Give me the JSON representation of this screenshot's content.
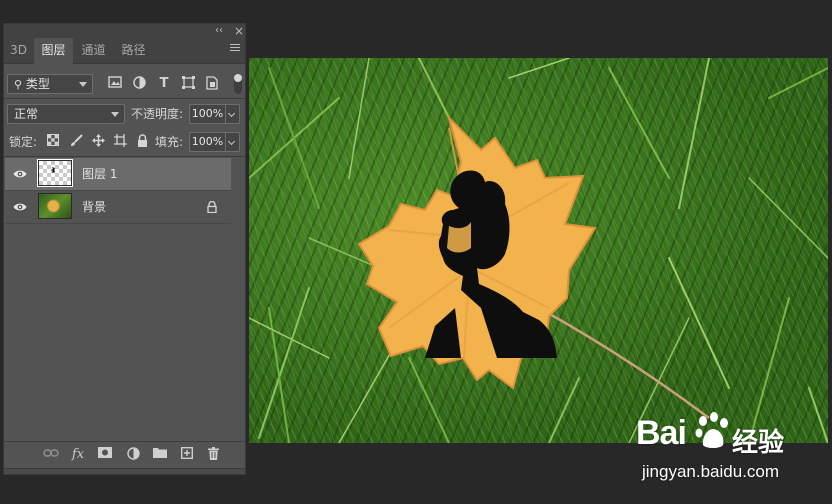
{
  "panel": {
    "collapse_glyph": "‹‹",
    "close_glyph": "×",
    "tabs": [
      {
        "label": "3D"
      },
      {
        "label": "图层"
      },
      {
        "label": "通道"
      },
      {
        "label": "路径"
      }
    ],
    "active_tab": "图层",
    "filter": {
      "label": "类型",
      "icon": "search-icon"
    },
    "filter_icons": [
      "image-filter-icon",
      "adjustment-filter-icon",
      "text-filter-icon",
      "shape-filter-icon",
      "smart-object-filter-icon"
    ],
    "blend_mode": "正常",
    "opacity_label": "不透明度:",
    "opacity_value": "100%",
    "lock_label": "锁定:",
    "lock_icons": [
      "lock-transparent-icon",
      "lock-paint-icon",
      "lock-position-icon",
      "lock-artboard-icon",
      "lock-all-icon"
    ],
    "fill_label": "填充:",
    "fill_value": "100%",
    "layers": [
      {
        "name": "图层 1",
        "selected": true,
        "visible": true,
        "locked": false
      },
      {
        "name": "背景",
        "selected": false,
        "visible": true,
        "locked": true
      }
    ],
    "bottom_icons": [
      "link-layers-icon",
      "fx-icon",
      "add-mask-icon",
      "new-adjustment-icon",
      "new-group-icon",
      "new-layer-icon",
      "delete-icon"
    ],
    "fx_text": "fx"
  },
  "watermark": {
    "logo": "Bai",
    "cn": "经验",
    "url": "jingyan.baidu.com"
  },
  "colors": {
    "panel_bg": "#535353",
    "app_bg": "#282828",
    "selected_layer": "#6b6b6b",
    "leaf_orange": "#f0a53c",
    "grass_green": "#3a701c"
  }
}
